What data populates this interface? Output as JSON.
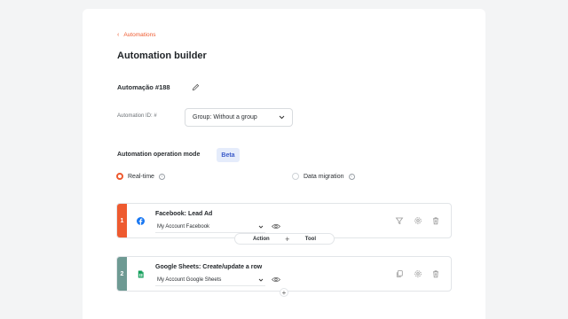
{
  "breadcrumb": {
    "chevron": "‹",
    "label": "Automations"
  },
  "page": {
    "title": "Automation builder"
  },
  "automation": {
    "name": "Automação #188",
    "id_label": "Automation ID: #"
  },
  "group_select": {
    "value": "Group: Without a group"
  },
  "mode": {
    "label": "Automation operation mode",
    "badge": "Beta",
    "options": [
      {
        "label": "Real-time",
        "selected": true
      },
      {
        "label": "Data migration",
        "selected": false
      }
    ]
  },
  "steps": [
    {
      "number": "1",
      "title": "Facebook: Lead Ad",
      "account": "My Account Facebook",
      "color": "#ee5a2f",
      "icon": "facebook-icon"
    },
    {
      "number": "2",
      "title": "Google Sheets: Create/update a row",
      "account": "My Account Google Sheets",
      "color": "#6e9a93",
      "icon": "google-sheets-icon"
    }
  ],
  "connector": {
    "action_label": "Action",
    "plus": "+",
    "tool_label": "Tool"
  },
  "colors": {
    "accent": "#ee5a2f",
    "beta_bg": "#e5ecfb",
    "beta_text": "#3b5bc9"
  }
}
